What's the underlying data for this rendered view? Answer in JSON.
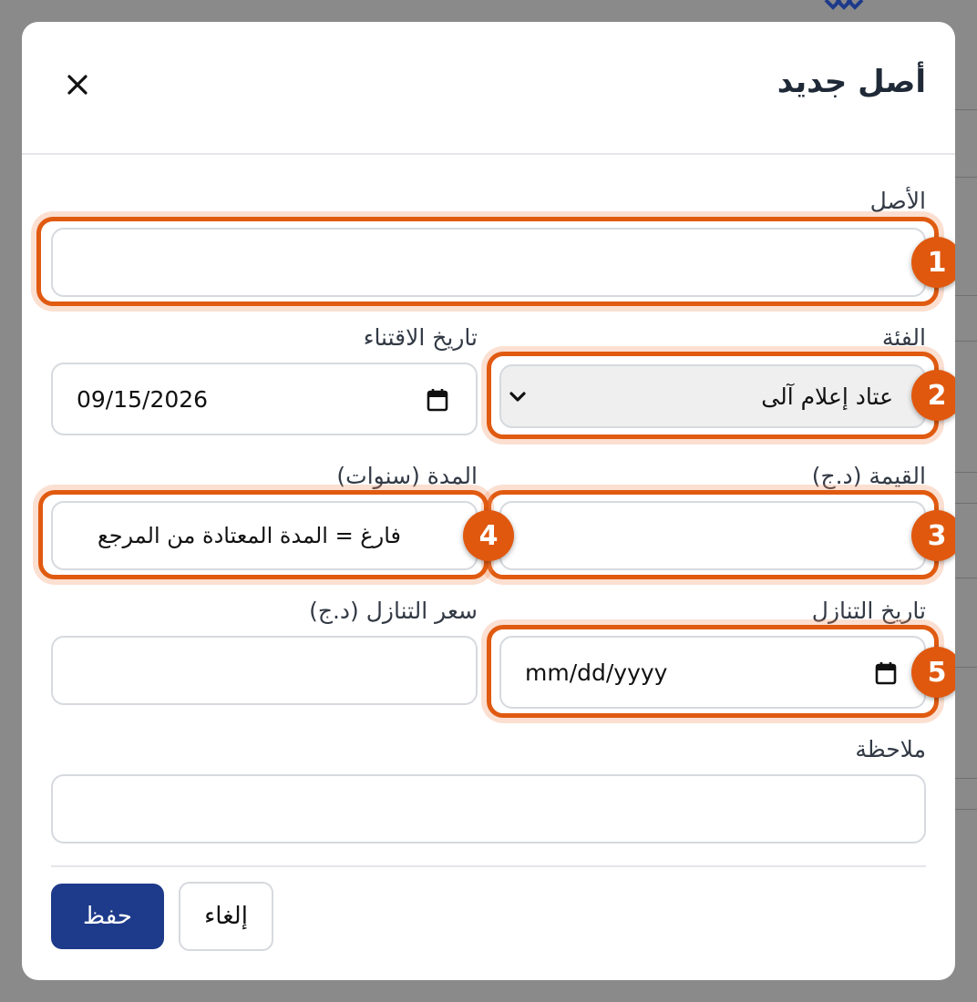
{
  "dialog": {
    "title": "أصل جديد",
    "close_symbol": "×"
  },
  "fields": {
    "asset": {
      "label": "الأصل",
      "value": "",
      "badge": "1"
    },
    "category": {
      "label": "الفئة",
      "value": "عتاد إعلام آلى",
      "badge": "2"
    },
    "acquisition_date": {
      "label": "تاريخ الاقتناء",
      "value": "09/15/2026"
    },
    "value": {
      "label": "القيمة (د.ج)",
      "value": "",
      "badge": "3"
    },
    "duration": {
      "label": "المدة (سنوات)",
      "placeholder": "فارغ = المدة المعتادة من المرجع",
      "badge": "4"
    },
    "disposal_date": {
      "label": "تاريخ التنازل",
      "value": "mm/dd/yyyy",
      "badge": "5"
    },
    "disposal_price": {
      "label": "سعر التنازل (د.ج)",
      "value": ""
    },
    "note": {
      "label": "ملاحظة",
      "value": ""
    }
  },
  "actions": {
    "save_label": "حفظ",
    "cancel_label": "إلغاء"
  },
  "colors": {
    "primary": "#1e3a8a",
    "highlight": "#e0580e"
  }
}
